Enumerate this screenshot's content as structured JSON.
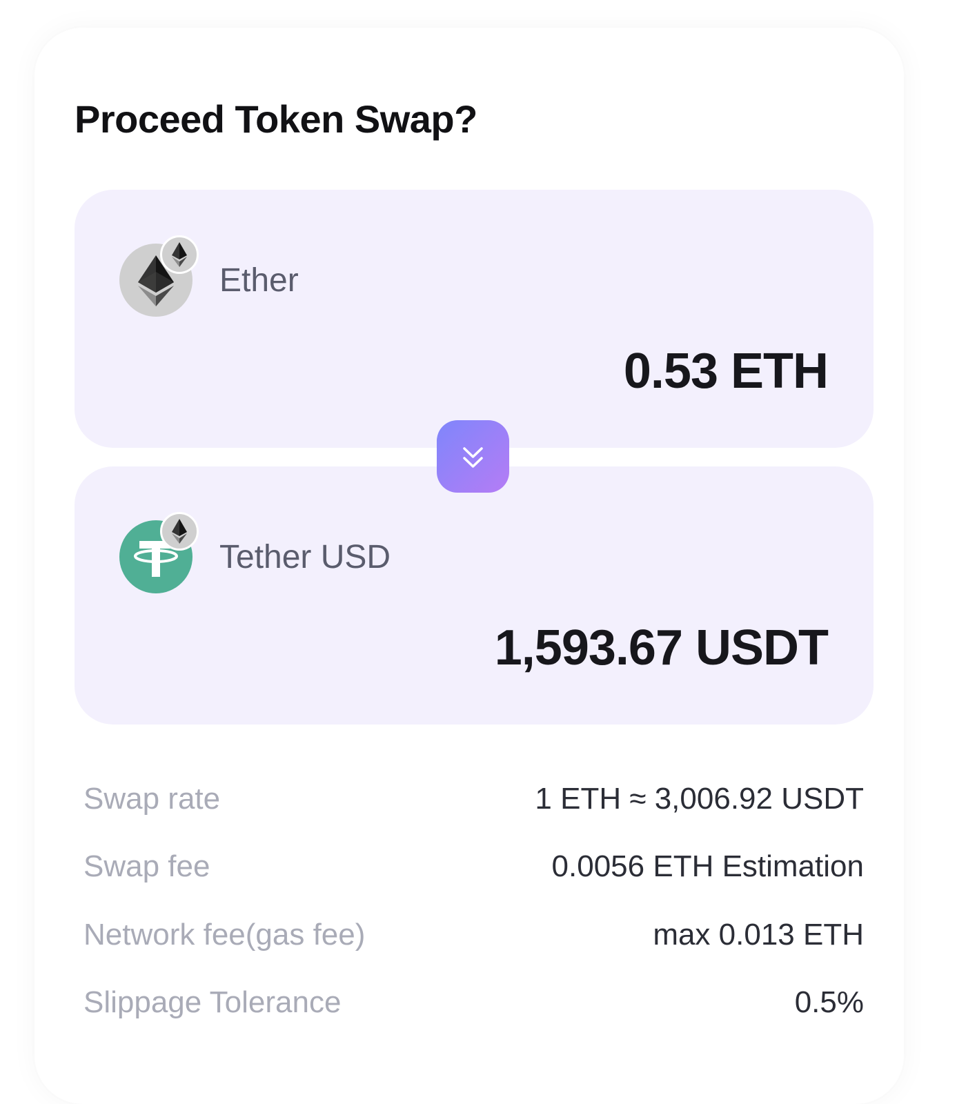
{
  "dialog": {
    "title": "Proceed Token Swap?"
  },
  "from_token": {
    "name": "Ether",
    "amount": "0.53 ETH",
    "icon": "ethereum-icon",
    "chain_icon": "ethereum-chain-icon"
  },
  "to_token": {
    "name": "Tether USD",
    "amount": "1,593.67 USDT",
    "icon": "tether-icon",
    "chain_icon": "ethereum-chain-icon"
  },
  "swap_button": {
    "icon": "double-chevron-down-icon"
  },
  "details": [
    {
      "label": "Swap rate",
      "value": "1 ETH ≈ 3,006.92 USDT"
    },
    {
      "label": "Swap fee",
      "value": "0.0056 ETH Estimation"
    },
    {
      "label": "Network fee(gas fee)",
      "value": "max 0.013 ETH"
    },
    {
      "label": "Slippage Tolerance",
      "value": "0.5%"
    }
  ],
  "colors": {
    "token_box_bg": "#f3f0fd",
    "swap_button_gradient_start": "#7f86fb",
    "swap_button_gradient_end": "#b57cf5",
    "tether_green": "#50af95",
    "ether_grey": "#cfcfcf",
    "label_grey": "#a9abb7"
  }
}
